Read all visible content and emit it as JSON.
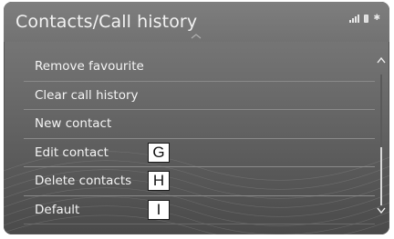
{
  "header": {
    "title": "Contacts/Call history",
    "status_icons": [
      "signal-icon",
      "phone-battery-icon",
      "bluetooth-icon"
    ]
  },
  "menu": {
    "items": [
      {
        "label": "Remove favourite"
      },
      {
        "label": "Clear call history"
      },
      {
        "label": "New contact"
      },
      {
        "label": "Edit contact",
        "callout": "G"
      },
      {
        "label": "Delete contacts",
        "callout": "H"
      },
      {
        "label": "Default",
        "callout": "I"
      }
    ]
  },
  "scrollbar": {
    "up_icon": "chevron-up-icon",
    "down_icon": "chevron-down-icon"
  },
  "colors": {
    "background": "#6a6a6a",
    "text": "#f4f4f4",
    "divider": "#8a8a8a"
  }
}
